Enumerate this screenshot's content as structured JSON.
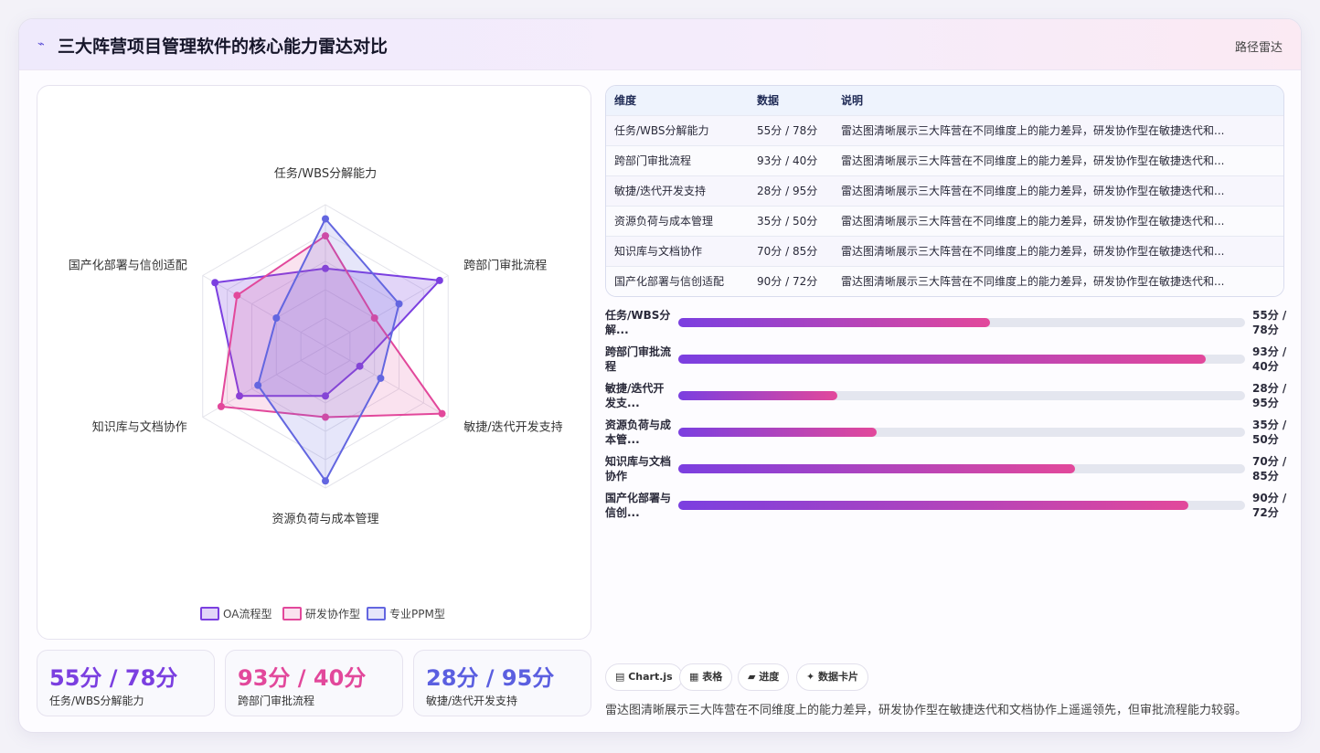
{
  "header": {
    "logo_icon": "⌁",
    "title": "三大阵营项目管理软件的核心能力雷达对比",
    "link": "路径雷达"
  },
  "chart_data": {
    "type": "radar",
    "axes": [
      "任务/WBS分解能力",
      "跨部门审批流程",
      "敏捷/迭代开发支持",
      "资源负荷与成本管理",
      "知识库与文档协作",
      "国产化部署与信创适配"
    ],
    "range": [
      0,
      100
    ],
    "rings": 5,
    "series": [
      {
        "name": "OA流程型",
        "color": "#7b3fe0",
        "fill": "rgba(123,63,224,0.22)",
        "values": [
          55,
          93,
          28,
          35,
          70,
          90
        ]
      },
      {
        "name": "研发协作型",
        "color": "#e2489b",
        "fill": "rgba(226,72,155,0.16)",
        "values": [
          78,
          40,
          95,
          50,
          85,
          72
        ]
      },
      {
        "name": "专业PPM型",
        "color": "#6366e0",
        "fill": "rgba(99,102,224,0.16)",
        "values": [
          90,
          60,
          45,
          95,
          55,
          40
        ]
      }
    ],
    "legend_position": "bottom"
  },
  "stats": [
    {
      "value": "55分 / 78分",
      "label": "任务/WBS分解能力",
      "color": "#7b3fe0"
    },
    {
      "value": "93分 / 40分",
      "label": "跨部门审批流程",
      "color": "#e2489b"
    },
    {
      "value": "28分 / 95分",
      "label": "敏捷/迭代开发支持",
      "color": "#5b5fe0"
    }
  ],
  "table": {
    "headers": [
      "维度",
      "数据",
      "说明"
    ],
    "rows": [
      [
        "任务/WBS分解能力",
        "55分 / 78分",
        "雷达图清晰展示三大阵营在不同维度上的能力差异，研发协作型在敏捷迭代和..."
      ],
      [
        "跨部门审批流程",
        "93分 / 40分",
        "雷达图清晰展示三大阵营在不同维度上的能力差异，研发协作型在敏捷迭代和..."
      ],
      [
        "敏捷/迭代开发支持",
        "28分 / 95分",
        "雷达图清晰展示三大阵营在不同维度上的能力差异，研发协作型在敏捷迭代和..."
      ],
      [
        "资源负荷与成本管理",
        "35分 / 50分",
        "雷达图清晰展示三大阵营在不同维度上的能力差异，研发协作型在敏捷迭代和..."
      ],
      [
        "知识库与文档协作",
        "70分 / 85分",
        "雷达图清晰展示三大阵营在不同维度上的能力差异，研发协作型在敏捷迭代和..."
      ],
      [
        "国产化部署与信创适配",
        "90分 / 72分",
        "雷达图清晰展示三大阵营在不同维度上的能力差异，研发协作型在敏捷迭代和..."
      ]
    ]
  },
  "bars": [
    {
      "label": "任务/WBS分解...",
      "value": "55分 / 78分",
      "percent": 55
    },
    {
      "label": "跨部门审批流程",
      "value": "93分 / 40分",
      "percent": 93
    },
    {
      "label": "敏捷/迭代开发支...",
      "value": "28分 / 95分",
      "percent": 28
    },
    {
      "label": "资源负荷与成本管...",
      "value": "35分 / 50分",
      "percent": 35
    },
    {
      "label": "知识库与文档协作",
      "value": "70分 / 85分",
      "percent": 70
    },
    {
      "label": "国产化部署与信创...",
      "value": "90分 / 72分",
      "percent": 90
    }
  ],
  "tags": [
    {
      "icon": "chart-icon",
      "label": "▤ Chart.js"
    },
    {
      "icon": "table-icon",
      "label": "▦ 表格"
    },
    {
      "icon": "progress-icon",
      "label": "▰ 进度"
    },
    {
      "icon": "card-icon",
      "label": "✦ 数据卡片"
    }
  ],
  "footer": {
    "text": "雷达图清晰展示三大阵营在不同维度上的能力差异，研发协作型在敏捷迭代和文档协作上遥遥领先，但审批流程能力较弱。"
  }
}
